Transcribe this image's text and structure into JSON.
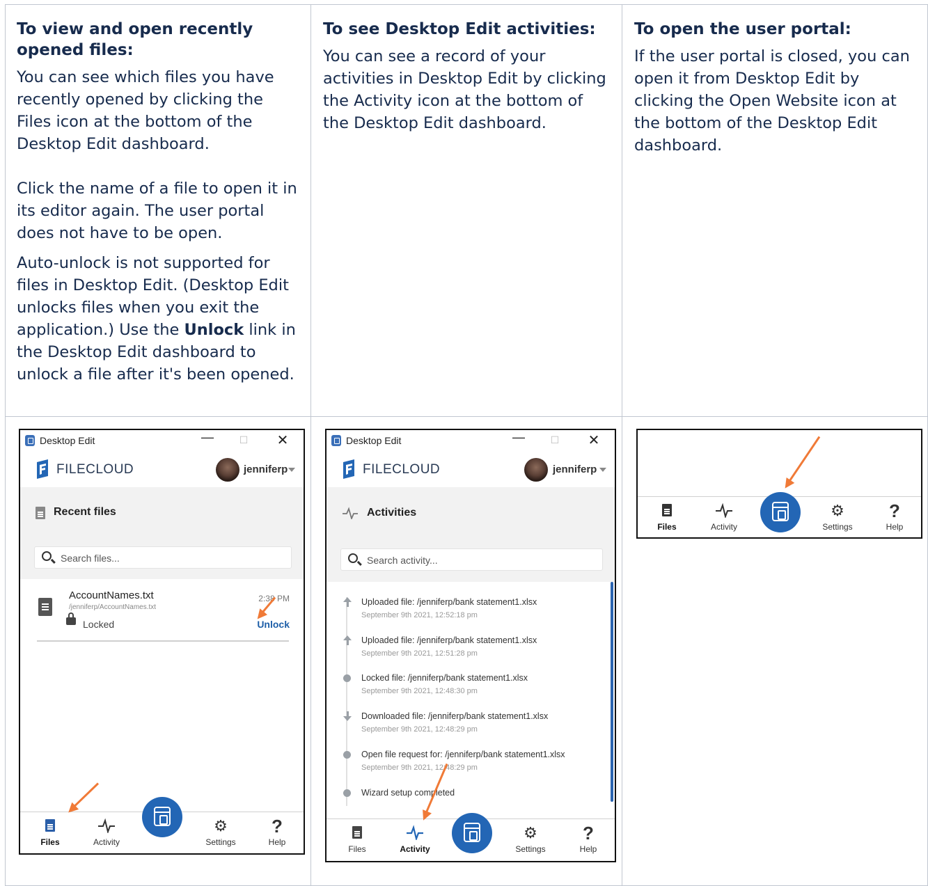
{
  "columns": [
    {
      "heading": "To view and open recently opened files:",
      "paragraphs": [
        "You can see which files you have recently opened by clicking the Files icon at the bottom of the Desktop Edit dashboard.",
        "Click the name of a file to open it in its editor again. The user portal does not have to be open."
      ],
      "p3_before": "Auto-unlock is not supported for files in Desktop Edit. (Desktop Edit unlocks files when you exit the application.) Use the ",
      "p3_bold": "Unlock",
      "p3_after": " link in the Desktop Edit dashboard to unlock a file after it's been opened."
    },
    {
      "heading": "To see Desktop Edit activities:",
      "paragraphs": [
        "You can see a record of your activities in Desktop Edit by clicking the Activity icon at the bottom of the Desktop Edit dashboard."
      ]
    },
    {
      "heading": "To open the user portal:",
      "paragraphs": [
        "If the user portal is closed, you can open it from  Desktop Edit by clicking the Open Website icon at the bottom of the Desktop Edit dashboard."
      ]
    }
  ],
  "app": {
    "window_title": "Desktop Edit",
    "brand": "FILECLOUD",
    "username": "jenniferp",
    "nav": {
      "files": "Files",
      "activity": "Activity",
      "settings": "Settings",
      "help": "Help"
    }
  },
  "files_window": {
    "section_title": "Recent files",
    "search_placeholder": "Search files...",
    "file": {
      "name": "AccountNames.txt",
      "path": "/jenniferp/AccountNames.txt",
      "time": "2:38 PM",
      "status": "Locked",
      "action": "Unlock"
    }
  },
  "activity_window": {
    "section_title": "Activities",
    "search_placeholder": "Search activity...",
    "items": [
      {
        "title": "Uploaded file: /jenniferp/bank statement1.xlsx",
        "time": "September 9th 2021, 12:52:18 pm",
        "marker": "up-arrow-icon"
      },
      {
        "title": "Uploaded file: /jenniferp/bank statement1.xlsx",
        "time": "September 9th 2021, 12:51:28 pm",
        "marker": "up-arrow-icon"
      },
      {
        "title": "Locked file: /jenniferp/bank statement1.xlsx",
        "time": "September 9th 2021, 12:48:30 pm",
        "marker": "dot-icon"
      },
      {
        "title": "Downloaded file: /jenniferp/bank statement1.xlsx",
        "time": "September 9th 2021, 12:48:29 pm",
        "marker": "down-arrow-icon"
      },
      {
        "title": "Open file request for: /jenniferp/bank statement1.xlsx",
        "time": "September 9th 2021, 12:48:29 pm",
        "marker": "dot-icon"
      },
      {
        "title": "Wizard setup completed",
        "time": "",
        "marker": "dot-icon"
      }
    ]
  },
  "colors": {
    "accent_blue": "#2366b5",
    "arrow_orange": "#f07a37",
    "border_gray": "#c1c7d0"
  }
}
